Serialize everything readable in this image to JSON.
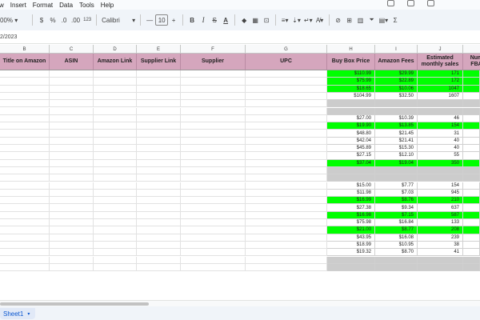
{
  "menu": [
    "w",
    "Insert",
    "Format",
    "Data",
    "Tools",
    "Help"
  ],
  "toolbar": {
    "zoom": "00%",
    "currency": "$",
    "percent": "%",
    "dec_decrease": ".0",
    "dec_increase": ".00",
    "number_format": "123",
    "font": "Calibri",
    "font_size": "10",
    "minus": "—",
    "plus": "+",
    "bold": "B",
    "italic": "I",
    "strike": "S",
    "text_color": "A",
    "sigma": "Σ"
  },
  "formula_value": "2/2023",
  "col_letters": [
    "B",
    "C",
    "D",
    "E",
    "F",
    "G",
    "H",
    "I",
    "J"
  ],
  "headers": [
    "Title on Amazon",
    "ASIN",
    "Amazon Link",
    "Supplier Link",
    "Supplier",
    "UPC",
    "Buy Box Price",
    "Amazon Fees",
    "Estimated monthly sales",
    "Num FBA"
  ],
  "rows": [
    {
      "h": "$110.99",
      "i": "$29.99",
      "j": "171",
      "fill": "green"
    },
    {
      "h": "$75.99",
      "i": "$22.89",
      "j": "172",
      "fill": "green"
    },
    {
      "h": "$18.65",
      "i": "$10.06",
      "j": "1047",
      "fill": "green"
    },
    {
      "h": "$104.99",
      "i": "$32.50",
      "j": "1607",
      "fill": ""
    },
    {
      "h": "",
      "i": "",
      "j": "",
      "fill": "gray"
    },
    {
      "h": "",
      "i": "",
      "j": "",
      "fill": "gray"
    },
    {
      "h": "$27.00",
      "i": "$10.39",
      "j": "46",
      "fill": ""
    },
    {
      "h": "$19.90",
      "i": "$13.85",
      "j": "154",
      "fill": "green"
    },
    {
      "h": "$48.80",
      "i": "$21.45",
      "j": "31",
      "fill": ""
    },
    {
      "h": "$42.04",
      "i": "$21.41",
      "j": "40",
      "fill": ""
    },
    {
      "h": "$45.89",
      "i": "$15.30",
      "j": "40",
      "fill": ""
    },
    {
      "h": "$27.15",
      "i": "$12.10",
      "j": "55",
      "fill": ""
    },
    {
      "h": "$37.04",
      "i": "$19.04",
      "j": "350",
      "fill": "green"
    },
    {
      "h": "",
      "i": "",
      "j": "",
      "fill": "gray"
    },
    {
      "h": "",
      "i": "",
      "j": "",
      "fill": "gray"
    },
    {
      "h": "$15.00",
      "i": "$7.77",
      "j": "154",
      "fill": ""
    },
    {
      "h": "$11.98",
      "i": "$7.03",
      "j": "945",
      "fill": ""
    },
    {
      "h": "$16.99",
      "i": "$8.76",
      "j": "210",
      "fill": "green"
    },
    {
      "h": "$27.38",
      "i": "$9.34",
      "j": "637",
      "fill": ""
    },
    {
      "h": "$16.98",
      "i": "$7.15",
      "j": "587",
      "fill": "green"
    },
    {
      "h": "$75.98",
      "i": "$16.84",
      "j": "133",
      "fill": ""
    },
    {
      "h": "$21.00",
      "i": "$8.77",
      "j": "208",
      "fill": "green"
    },
    {
      "h": "$43.95",
      "i": "$16.08",
      "j": "239",
      "fill": ""
    },
    {
      "h": "$18.99",
      "i": "$10.95",
      "j": "38",
      "fill": ""
    },
    {
      "h": "$19.32",
      "i": "$8.70",
      "j": "41",
      "fill": ""
    },
    {
      "h": "",
      "i": "",
      "j": "",
      "fill": "gray"
    },
    {
      "h": "",
      "i": "",
      "j": "",
      "fill": "gray"
    }
  ],
  "sheet_tab": "Sheet1",
  "colors": {
    "header_pink": "#d5a6bd",
    "green": "#00ff00",
    "gray": "#cccccc"
  }
}
